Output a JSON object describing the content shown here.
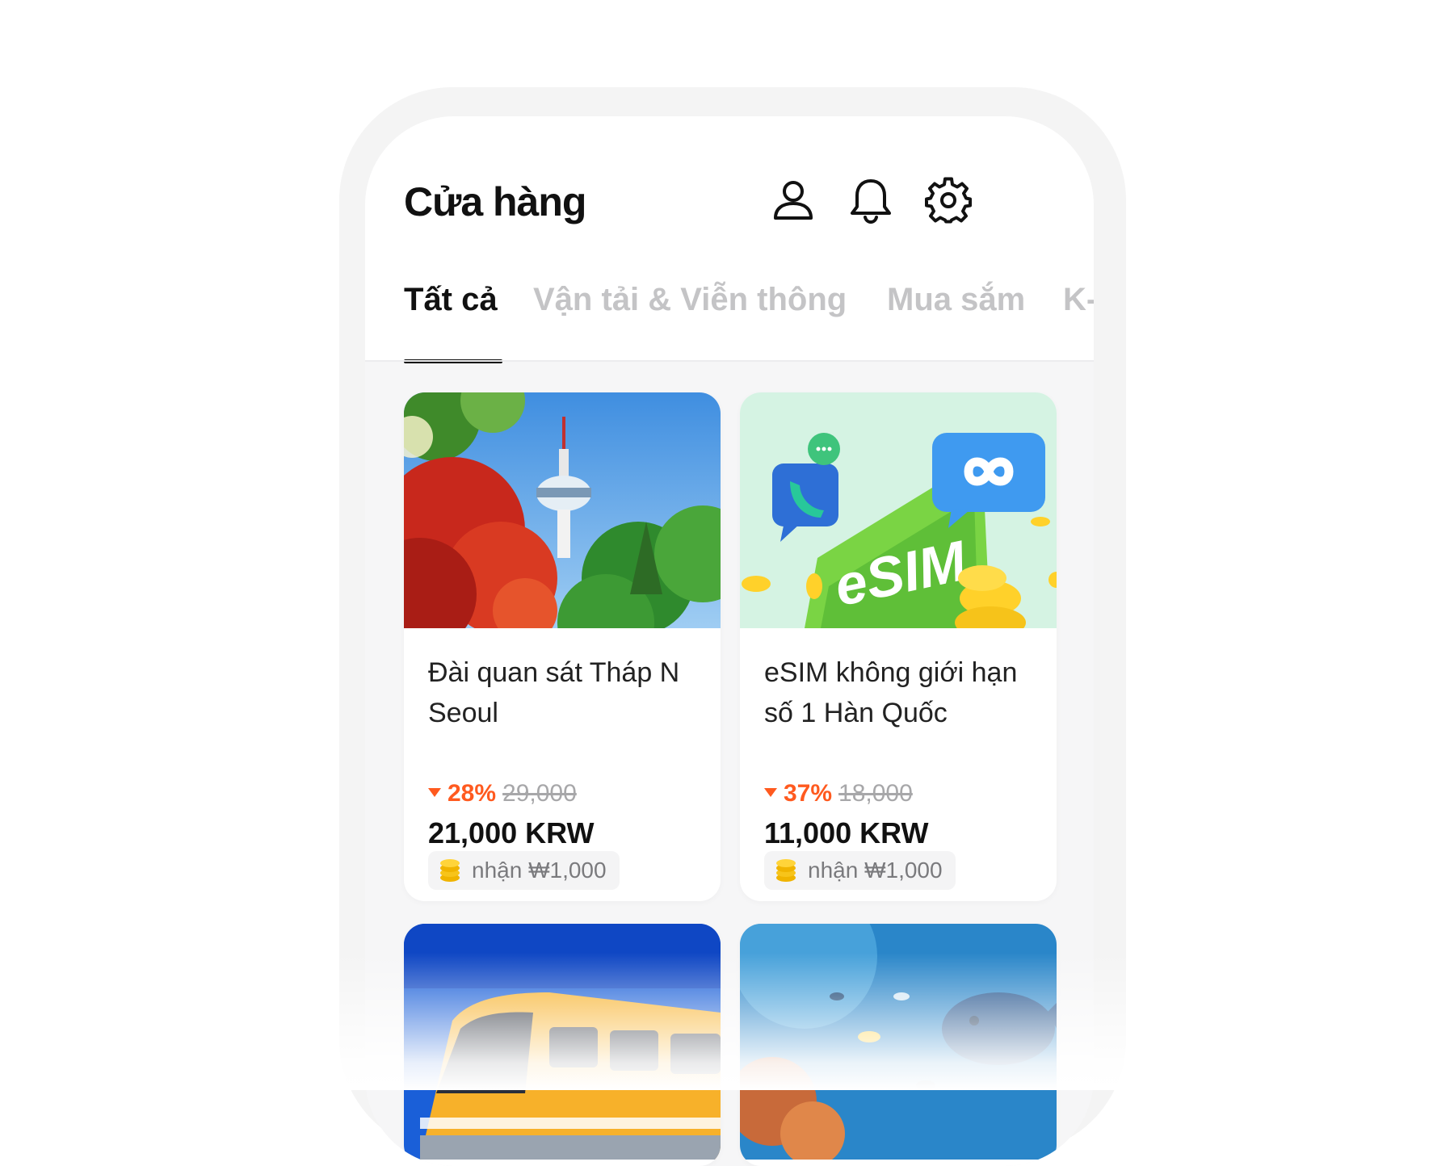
{
  "header": {
    "title": "Cửa hàng",
    "icons": [
      "profile-icon",
      "bell-icon",
      "gear-icon"
    ]
  },
  "tabs": [
    {
      "label": "Tất cả",
      "active": true
    },
    {
      "label": "Vận tải & Viễn thông",
      "active": false
    },
    {
      "label": "Mua sắm",
      "active": false
    },
    {
      "label": "K-",
      "active": false
    }
  ],
  "products": [
    {
      "name": "Đài quan sát Tháp N Seoul",
      "discount": "28%",
      "original_price": "29,000",
      "price": "21,000 KRW",
      "reward": "nhận ₩1,000"
    },
    {
      "name": "eSIM không giới hạn số 1 Hàn Quốc",
      "discount": "37%",
      "original_price": "18,000",
      "price": "11,000 KRW",
      "reward": "nhận ₩1,000"
    }
  ],
  "esim_image_text": "eSIM",
  "colors": {
    "accent_discount": "#ff5a1f",
    "tab_active": "#111111",
    "tab_inactive": "#c4c4c6"
  }
}
